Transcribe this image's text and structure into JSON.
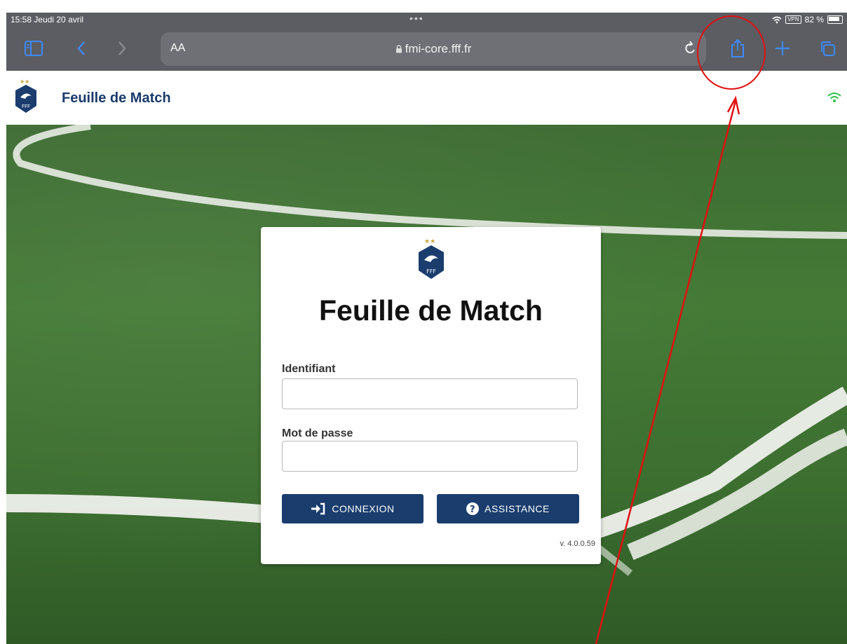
{
  "status_bar": {
    "time_date": "15:58  Jeudi 20 avril",
    "multitask_dots": "•••",
    "vpn": "VPN",
    "battery": "82 %"
  },
  "browser": {
    "text_size_label": "AA",
    "url": "fmi-core.fff.fr",
    "icons": [
      "sidebar-icon",
      "back-icon",
      "forward-icon",
      "lock-icon",
      "reload-icon",
      "share-icon",
      "new-tab-icon",
      "tabs-icon"
    ]
  },
  "app_header": {
    "title": "Feuille de Match",
    "logo_text": "FFF"
  },
  "login": {
    "logo_text": "FFF",
    "title": "Feuille de Match",
    "username_label": "Identifiant",
    "username_value": "",
    "password_label": "Mot de passe",
    "password_value": "",
    "connect_label": "CONNEXION",
    "assist_label": "ASSISTANCE",
    "version": "v. 4.0.0.59"
  },
  "colors": {
    "brand_navy": "#1a3d6e",
    "annotation_red": "#e01010",
    "wifi_green": "#2fbf4a",
    "browser_chrome": "#5b5d62"
  }
}
